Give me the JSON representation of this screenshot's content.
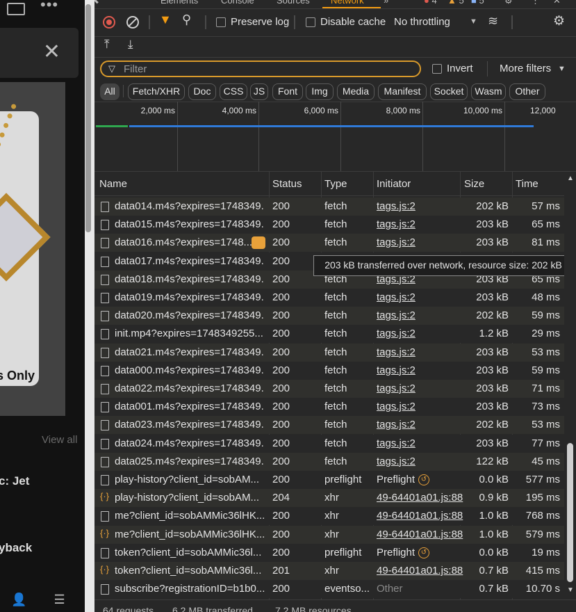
{
  "page": {
    "close_glyph": "✕",
    "dots_glyph": "•••",
    "badge_text": "s Only",
    "view_all": "View all",
    "product_title": "c: Jet",
    "playback_title": "yback"
  },
  "devtools": {
    "tabs": [
      "Elements",
      "Console",
      "Sources",
      "Network",
      "»"
    ],
    "active_tab": "Network",
    "issue_counts": [
      "4",
      "5",
      "5"
    ],
    "toolbar": {
      "preserve_log": "Preserve log",
      "disable_cache": "Disable cache",
      "throttling": "No throttling"
    },
    "filter": {
      "placeholder": "Filter",
      "invert": "Invert",
      "more_filters": "More filters"
    },
    "type_filters": [
      "All",
      "Fetch/XHR",
      "Doc",
      "CSS",
      "JS",
      "Font",
      "Img",
      "Media",
      "Manifest",
      "Socket",
      "Wasm",
      "Other"
    ],
    "overview_ticks": [
      "2,000 ms",
      "4,000 ms",
      "6,000 ms",
      "8,000 ms",
      "10,000 ms",
      "12,000"
    ],
    "columns": [
      "Name",
      "Status",
      "Type",
      "Initiator",
      "Size",
      "Time"
    ],
    "rows": [
      {
        "name": "data014.m4s?expires=1748349...",
        "status": "200",
        "type": "fetch",
        "initiator": "tags.js:2",
        "size": "202 kB",
        "time": "57 ms",
        "icon": "doc"
      },
      {
        "name": "data015.m4s?expires=1748349...",
        "status": "200",
        "type": "fetch",
        "initiator": "tags.js:2",
        "size": "203 kB",
        "time": "65 ms",
        "icon": "doc"
      },
      {
        "name": "data016.m4s?expires=1748...",
        "status": "200",
        "type": "fetch",
        "initiator": "tags.js:2",
        "size": "203 kB",
        "time": "81 ms",
        "icon": "doc"
      },
      {
        "name": "data017.m4s?expires=1748349...",
        "status": "200",
        "type": "",
        "initiator": "",
        "size": "",
        "time": "",
        "icon": "doc"
      },
      {
        "name": "data018.m4s?expires=1748349...",
        "status": "200",
        "type": "fetch",
        "initiator": "tags.js:2",
        "size": "203 kB",
        "time": "65 ms",
        "icon": "doc"
      },
      {
        "name": "data019.m4s?expires=1748349...",
        "status": "200",
        "type": "fetch",
        "initiator": "tags.js:2",
        "size": "203 kB",
        "time": "48 ms",
        "icon": "doc"
      },
      {
        "name": "data020.m4s?expires=1748349...",
        "status": "200",
        "type": "fetch",
        "initiator": "tags.js:2",
        "size": "202 kB",
        "time": "59 ms",
        "icon": "doc"
      },
      {
        "name": "init.mp4?expires=1748349255...",
        "status": "200",
        "type": "fetch",
        "initiator": "tags.js:2",
        "size": "1.2 kB",
        "time": "29 ms",
        "icon": "doc"
      },
      {
        "name": "data021.m4s?expires=1748349...",
        "status": "200",
        "type": "fetch",
        "initiator": "tags.js:2",
        "size": "203 kB",
        "time": "53 ms",
        "icon": "doc"
      },
      {
        "name": "data000.m4s?expires=1748349...",
        "status": "200",
        "type": "fetch",
        "initiator": "tags.js:2",
        "size": "203 kB",
        "time": "59 ms",
        "icon": "doc"
      },
      {
        "name": "data022.m4s?expires=1748349...",
        "status": "200",
        "type": "fetch",
        "initiator": "tags.js:2",
        "size": "203 kB",
        "time": "71 ms",
        "icon": "doc"
      },
      {
        "name": "data001.m4s?expires=1748349...",
        "status": "200",
        "type": "fetch",
        "initiator": "tags.js:2",
        "size": "203 kB",
        "time": "73 ms",
        "icon": "doc"
      },
      {
        "name": "data023.m4s?expires=1748349...",
        "status": "200",
        "type": "fetch",
        "initiator": "tags.js:2",
        "size": "202 kB",
        "time": "53 ms",
        "icon": "doc"
      },
      {
        "name": "data024.m4s?expires=1748349...",
        "status": "200",
        "type": "fetch",
        "initiator": "tags.js:2",
        "size": "203 kB",
        "time": "77 ms",
        "icon": "doc"
      },
      {
        "name": "data025.m4s?expires=1748349...",
        "status": "200",
        "type": "fetch",
        "initiator": "tags.js:2",
        "size": "122 kB",
        "time": "45 ms",
        "icon": "doc"
      },
      {
        "name": "play-history?client_id=sobAM...",
        "status": "200",
        "type": "preflight",
        "initiator": "Preflight",
        "size": "0.0 kB",
        "time": "577 ms",
        "icon": "doc"
      },
      {
        "name": "play-history?client_id=sobAM...",
        "status": "204",
        "type": "xhr",
        "initiator": "49-64401a01.js:88",
        "size": "0.9 kB",
        "time": "195 ms",
        "icon": "xhr"
      },
      {
        "name": "me?client_id=sobAMMic36lHK...",
        "status": "200",
        "type": "xhr",
        "initiator": "49-64401a01.js:88",
        "size": "1.0 kB",
        "time": "768 ms",
        "icon": "doc"
      },
      {
        "name": "me?client_id=sobAMMic36lHK...",
        "status": "200",
        "type": "xhr",
        "initiator": "49-64401a01.js:88",
        "size": "1.0 kB",
        "time": "579 ms",
        "icon": "xhr"
      },
      {
        "name": "token?client_id=sobAMMic36l...",
        "status": "200",
        "type": "preflight",
        "initiator": "Preflight",
        "size": "0.0 kB",
        "time": "19 ms",
        "icon": "doc"
      },
      {
        "name": "token?client_id=sobAMMic36l...",
        "status": "201",
        "type": "xhr",
        "initiator": "49-64401a01.js:88",
        "size": "0.7 kB",
        "time": "415 ms",
        "icon": "xhr"
      },
      {
        "name": "subscribe?registrationID=b1b0...",
        "status": "200",
        "type": "eventso...",
        "initiator": "Other",
        "size": "0.7 kB",
        "time": "10.70 s",
        "icon": "doc"
      }
    ],
    "tooltip": "203 kB transferred over network, resource size: 202 kB",
    "status_bar": [
      "64 requests",
      "6.2 MB transferred",
      "7.2 MB resources"
    ]
  }
}
